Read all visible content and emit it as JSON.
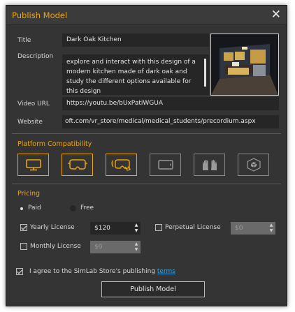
{
  "dialog": {
    "title": "Publish Model",
    "close_icon": "close-icon"
  },
  "form": {
    "title_label": "Title",
    "title_value": "Dark Oak Kitchen",
    "description_label": "Description",
    "description_value": "explore and interact with this design of a modern kitchen made of dark oak and study the different options available for this design",
    "video_label": "Video URL",
    "video_value": "https://youtu.be/bUxPatiWGUA",
    "website_label": "Website",
    "website_value": "oft.com/vr_store/medical/medical_students/precordium.aspx"
  },
  "platform": {
    "section_title": "Platform Compatibility",
    "items": [
      {
        "icon": "monitor-icon",
        "selected": true
      },
      {
        "icon": "vr-headset-icon",
        "selected": true
      },
      {
        "icon": "vr-headset-hand-icon",
        "selected": true
      },
      {
        "icon": "tablet-icon",
        "selected": false
      },
      {
        "icon": "hands-icon",
        "selected": false
      },
      {
        "icon": "ar-cube-icon",
        "selected": false
      }
    ]
  },
  "pricing": {
    "section_title": "Pricing",
    "paid_label": "Paid",
    "free_label": "Free",
    "selected": "Paid",
    "yearly_label": "Yearly License",
    "yearly_checked": true,
    "yearly_price": "$120",
    "perpetual_label": "Perpetual License",
    "perpetual_checked": false,
    "perpetual_price": "$0",
    "monthly_label": "Monthly License",
    "monthly_checked": false,
    "monthly_price": "$0"
  },
  "agreement": {
    "checked": true,
    "text": "I agree to the SimLab Store's publishing ",
    "link_text": "terms"
  },
  "actions": {
    "publish_label": "Publish Model"
  },
  "colors": {
    "accent": "#f0a600",
    "background": "#343434",
    "field": "#262626",
    "link": "#3aa0e8"
  }
}
